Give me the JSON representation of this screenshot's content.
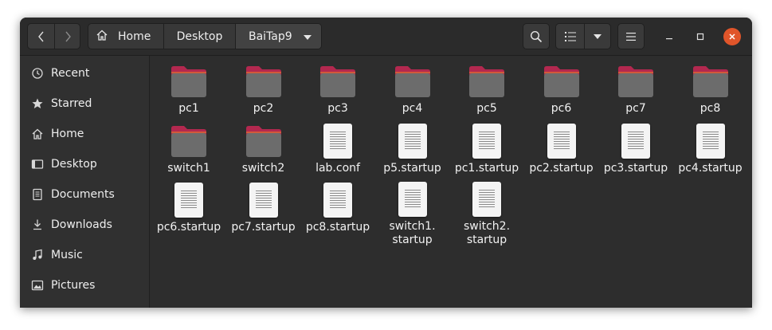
{
  "colors": {
    "folder_tab": "#b3284f",
    "folder_tab_edge": "#d15a3b",
    "folder_body": "#6c6c6c",
    "close_button": "#e0552a"
  },
  "header": {
    "breadcrumb": [
      "Home",
      "Desktop",
      "BaiTap9"
    ]
  },
  "sidebar": {
    "items": [
      {
        "label": "Recent",
        "icon": "clock-icon"
      },
      {
        "label": "Starred",
        "icon": "star-icon"
      },
      {
        "label": "Home",
        "icon": "home-icon"
      },
      {
        "label": "Desktop",
        "icon": "desktop-icon"
      },
      {
        "label": "Documents",
        "icon": "document-icon"
      },
      {
        "label": "Downloads",
        "icon": "download-icon"
      },
      {
        "label": "Music",
        "icon": "music-icon"
      },
      {
        "label": "Pictures",
        "icon": "picture-icon"
      }
    ]
  },
  "files": [
    {
      "name": "pc1",
      "type": "folder"
    },
    {
      "name": "pc2",
      "type": "folder"
    },
    {
      "name": "pc3",
      "type": "folder"
    },
    {
      "name": "pc4",
      "type": "folder"
    },
    {
      "name": "pc5",
      "type": "folder"
    },
    {
      "name": "pc6",
      "type": "folder"
    },
    {
      "name": "pc7",
      "type": "folder"
    },
    {
      "name": "pc8",
      "type": "folder"
    },
    {
      "name": "switch1",
      "type": "folder"
    },
    {
      "name": "switch2",
      "type": "folder"
    },
    {
      "name": "lab.conf",
      "type": "file"
    },
    {
      "name": "p5.startup",
      "type": "file"
    },
    {
      "name": "pc1.startup",
      "type": "file"
    },
    {
      "name": "pc2.startup",
      "type": "file"
    },
    {
      "name": "pc3.startup",
      "type": "file"
    },
    {
      "name": "pc4.startup",
      "type": "file"
    },
    {
      "name": "pc6.startup",
      "type": "file"
    },
    {
      "name": "pc7.startup",
      "type": "file"
    },
    {
      "name": "pc8.startup",
      "type": "file"
    },
    {
      "name": "switch1.\nstartup",
      "type": "file"
    },
    {
      "name": "switch2.\nstartup",
      "type": "file"
    }
  ]
}
